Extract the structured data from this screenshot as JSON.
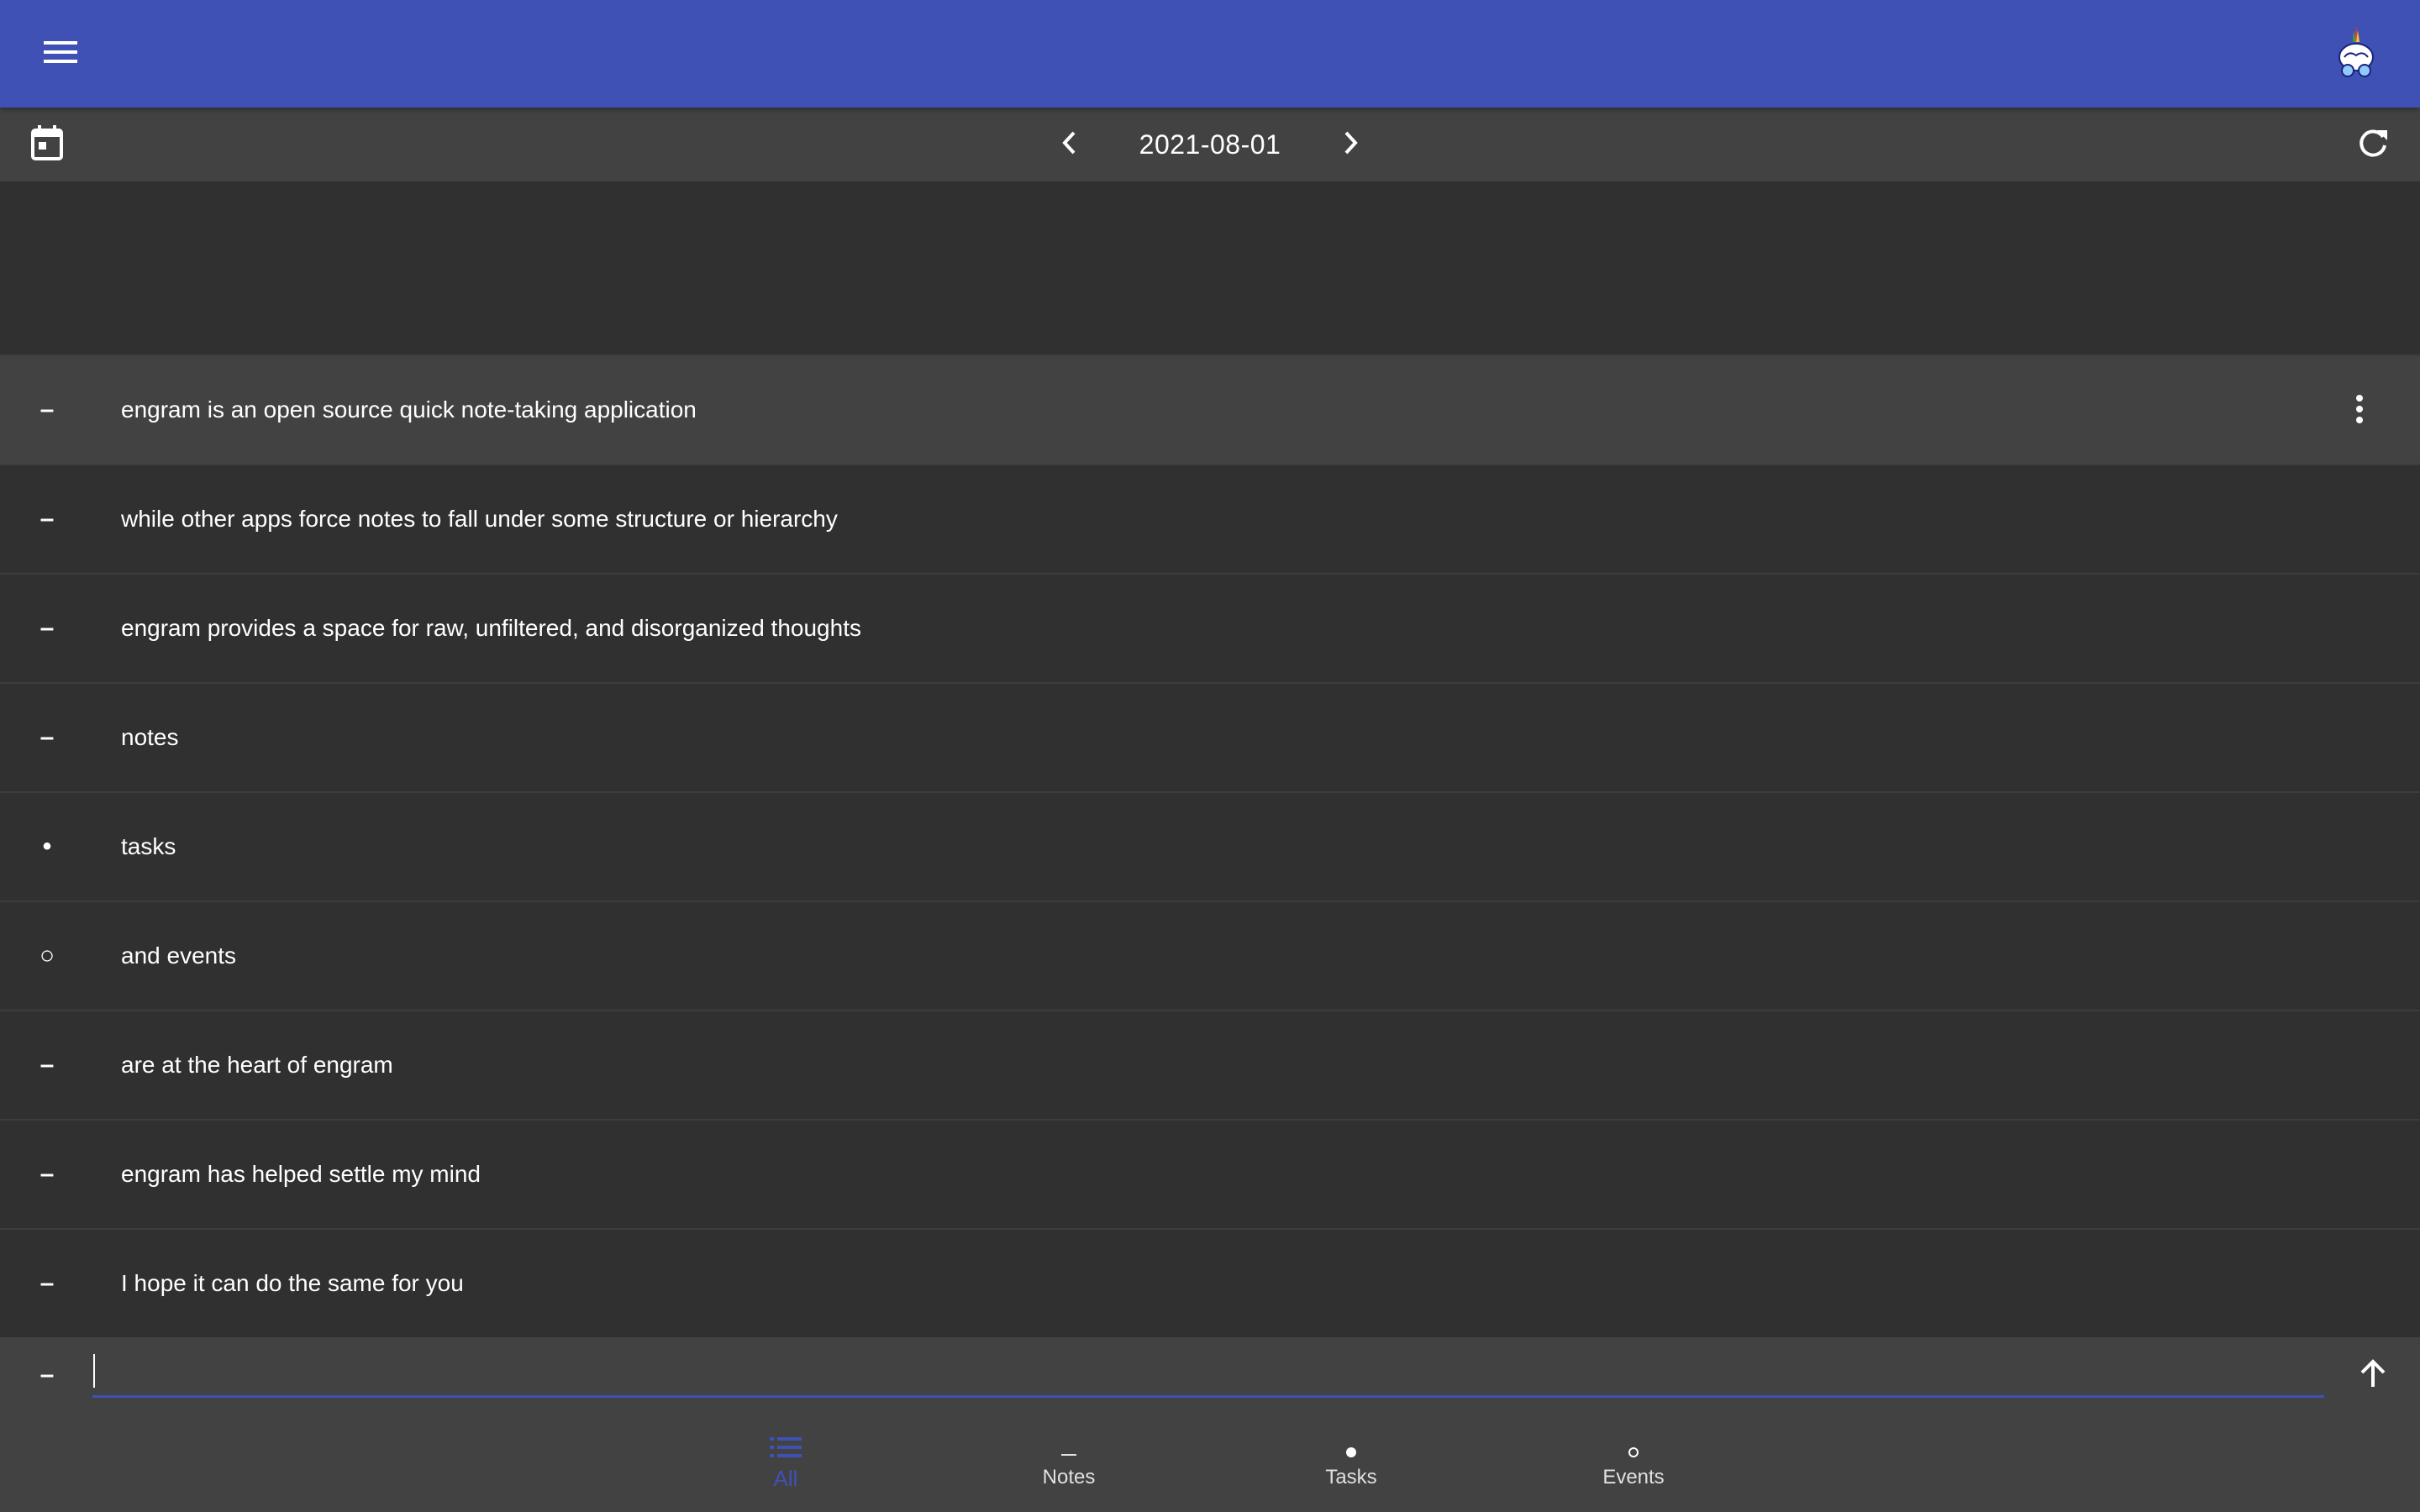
{
  "app_bar": {
    "menu_icon": "menu-icon",
    "logo_icon": "engram-brain-logo"
  },
  "date_bar": {
    "date": "2021-08-01",
    "calendar_icon": "calendar-icon",
    "prev_icon": "chevron-left-icon",
    "next_icon": "chevron-right-icon",
    "refresh_icon": "refresh-icon"
  },
  "entries": [
    {
      "type": "note",
      "symbol": "–",
      "text": "engram is an open source quick note-taking application",
      "active": true
    },
    {
      "type": "note",
      "symbol": "–",
      "text": "while other apps force notes to fall under some structure or hierarchy"
    },
    {
      "type": "note",
      "symbol": "–",
      "text": "engram provides a space for raw, unfiltered, and disorganized thoughts"
    },
    {
      "type": "note",
      "symbol": "–",
      "text": "notes"
    },
    {
      "type": "task",
      "symbol": "•",
      "text": "tasks"
    },
    {
      "type": "event",
      "symbol": "○",
      "text": "and events"
    },
    {
      "type": "note",
      "symbol": "–",
      "text": "are at the heart of engram"
    },
    {
      "type": "note",
      "symbol": "–",
      "text": "engram has helped settle my mind"
    },
    {
      "type": "note",
      "symbol": "–",
      "text": "I hope it can do the same for you"
    }
  ],
  "input": {
    "type_symbol": "–",
    "value": "",
    "placeholder": "",
    "send_icon": "arrow-up-icon"
  },
  "bottom_nav": {
    "tabs": [
      {
        "label": "All",
        "icon": "list-icon",
        "selected": true
      },
      {
        "label": "Notes",
        "icon": "dash-icon"
      },
      {
        "label": "Tasks",
        "icon": "dot-icon"
      },
      {
        "label": "Events",
        "icon": "circle-icon"
      }
    ]
  },
  "colors": {
    "primary": "#3f51b5",
    "background": "#303030",
    "surface": "#424242",
    "text": "#ffffff"
  }
}
